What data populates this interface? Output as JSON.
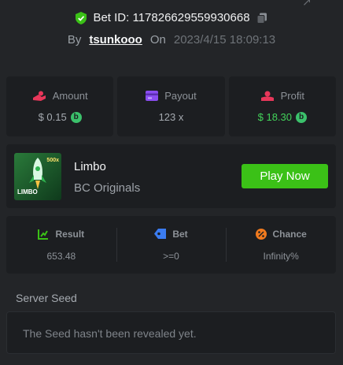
{
  "header": {
    "bet_id_prefix": "Bet ID:",
    "bet_id": "117826629559930668",
    "by_label": "By",
    "username": "tsunkooo",
    "on_label": "On",
    "timestamp": "2023/4/15 18:09:13"
  },
  "stats": {
    "amount": {
      "label": "Amount",
      "value": "$ 0.15"
    },
    "payout": {
      "label": "Payout",
      "value": "123 x"
    },
    "profit": {
      "label": "Profit",
      "value": "$ 18.30"
    },
    "coin_glyph": "b"
  },
  "game": {
    "name": "Limbo",
    "provider": "BC Originals",
    "thumb_text": "LIMBO",
    "thumb_badge": "500x",
    "play_label": "Play Now"
  },
  "info": {
    "result": {
      "label": "Result",
      "value": "653.48"
    },
    "bet": {
      "label": "Bet",
      "value": ">=0"
    },
    "chance": {
      "label": "Chance",
      "value": "Infinity%"
    }
  },
  "seed": {
    "title": "Server Seed",
    "message": "The Seed hasn't been revealed yet."
  },
  "colors": {
    "background": "#232528",
    "panel": "#1c1e21",
    "accent_green": "#3bc117",
    "profit_green": "#42d35a",
    "amount_icon": "#e8375a",
    "payout_icon": "#8a4df0",
    "profit_icon": "#e8375a",
    "result_icon": "#3bc117",
    "bet_icon": "#3b7cf0",
    "chance_icon": "#f07a1e"
  }
}
